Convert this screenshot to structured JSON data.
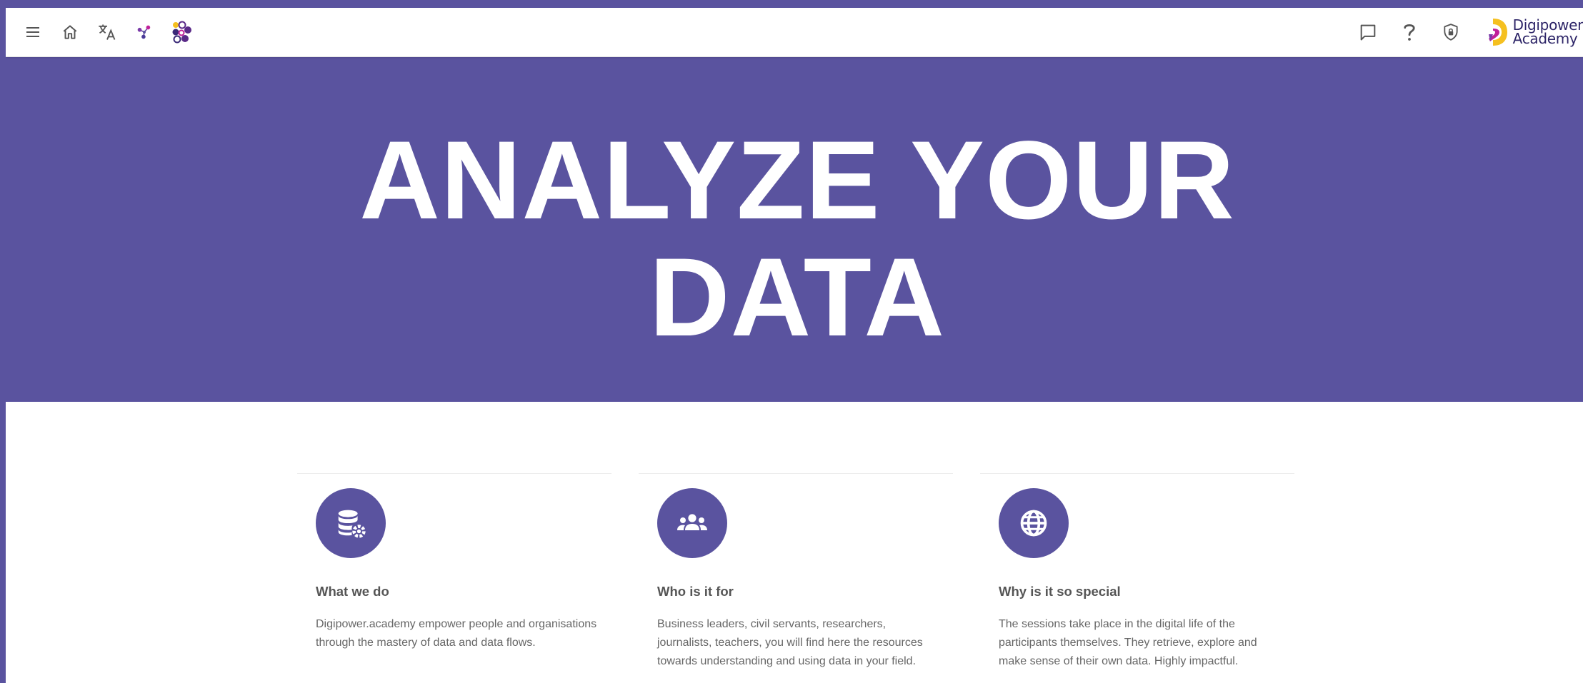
{
  "toolbar": {
    "left_icons": [
      "menu-icon",
      "home-icon",
      "translate-icon",
      "graph-icon",
      "circles-logo-icon"
    ],
    "right_icons": [
      "chat-icon",
      "help-icon",
      "privacy-shield-icon"
    ],
    "logo": {
      "line1": "Digipower",
      "line2": "Academy"
    }
  },
  "hero": {
    "title_line1": "ANALYZE YOUR",
    "title_line2": "DATA"
  },
  "features": [
    {
      "icon": "database-gear-icon",
      "title": "What we do",
      "description": "Digipower.academy empower people and organisations through the mastery of data and data flows."
    },
    {
      "icon": "people-group-icon",
      "title": "Who is it for",
      "description": "Business leaders, civil servants, researchers, journalists, teachers, you will find here the resources towards understanding and using data in your field."
    },
    {
      "icon": "globe-icon",
      "title": "Why is it so special",
      "description": "The sessions take place in the digital life of the participants themselves. They retrieve, explore and make sense of their own data. Highly impactful."
    }
  ],
  "colors": {
    "brand": "#5a539f",
    "text_heading": "#555555",
    "text_body": "#666666",
    "logo_text": "#2e2668",
    "logo_accent_yellow": "#f5c020",
    "logo_accent_magenta": "#c0209a"
  }
}
